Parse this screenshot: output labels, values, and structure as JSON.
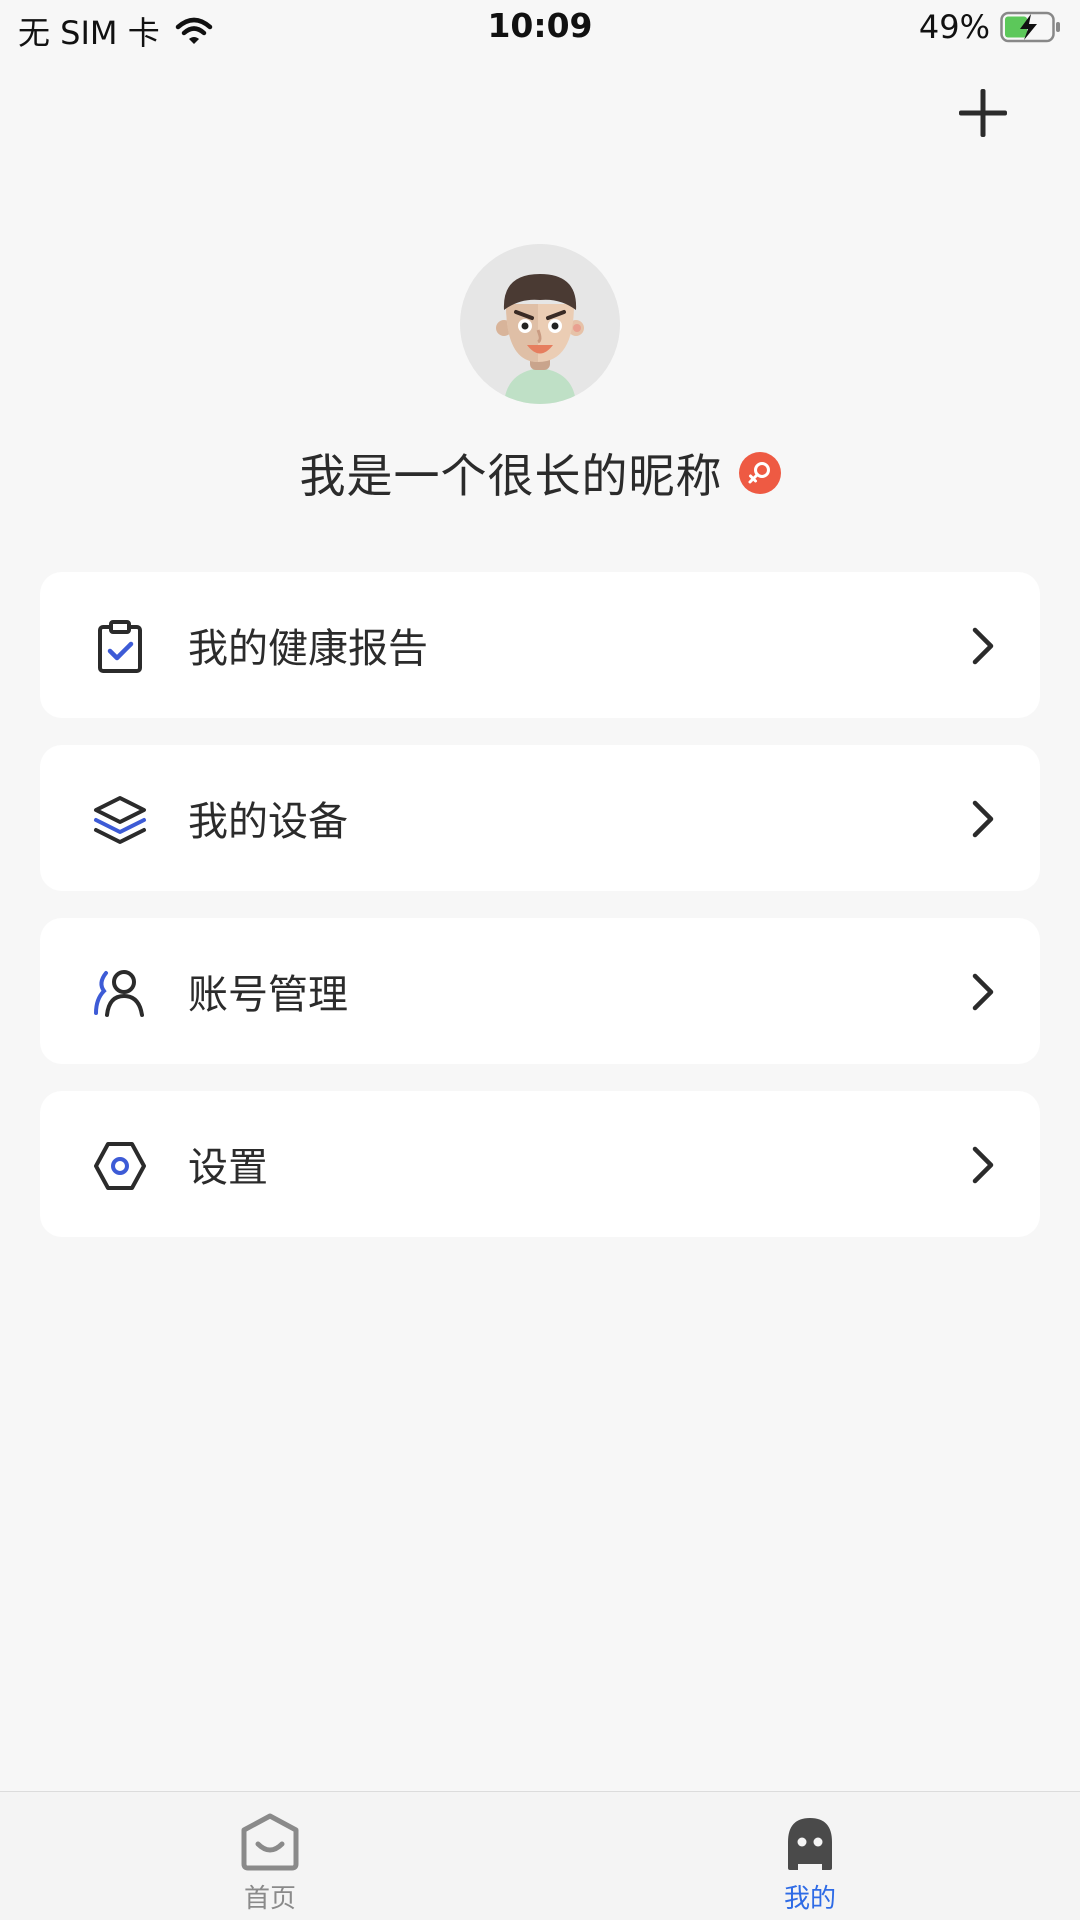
{
  "status_bar": {
    "carrier": "无 SIM 卡",
    "time": "10:09",
    "battery": "49%",
    "battery_level": 0.49,
    "icons": [
      "wifi-icon",
      "battery-charging-icon"
    ]
  },
  "header": {
    "add_icon": "plus-icon"
  },
  "profile": {
    "nickname": "我是一个很长的昵称",
    "avatar_icon": "cartoon-avatar",
    "gender_icon": "female-icon",
    "gender_color": "#ee5a43"
  },
  "menu": {
    "items": [
      {
        "label": "我的健康报告",
        "icon": "clipboard-check-icon"
      },
      {
        "label": "我的设备",
        "icon": "layers-icon"
      },
      {
        "label": "账号管理",
        "icon": "user-icon"
      },
      {
        "label": "设置",
        "icon": "hexagon-settings-icon"
      }
    ]
  },
  "tab_bar": {
    "tabs": [
      {
        "label": "首页",
        "icon": "home-face-icon",
        "active": false
      },
      {
        "label": "我的",
        "icon": "robot-face-icon",
        "active": true
      }
    ],
    "active_color": "#2e6be6",
    "inactive_color": "#8a8a8a"
  },
  "colors": {
    "accent": "#3d5bd6",
    "background": "#f7f7f7",
    "card": "#ffffff"
  }
}
